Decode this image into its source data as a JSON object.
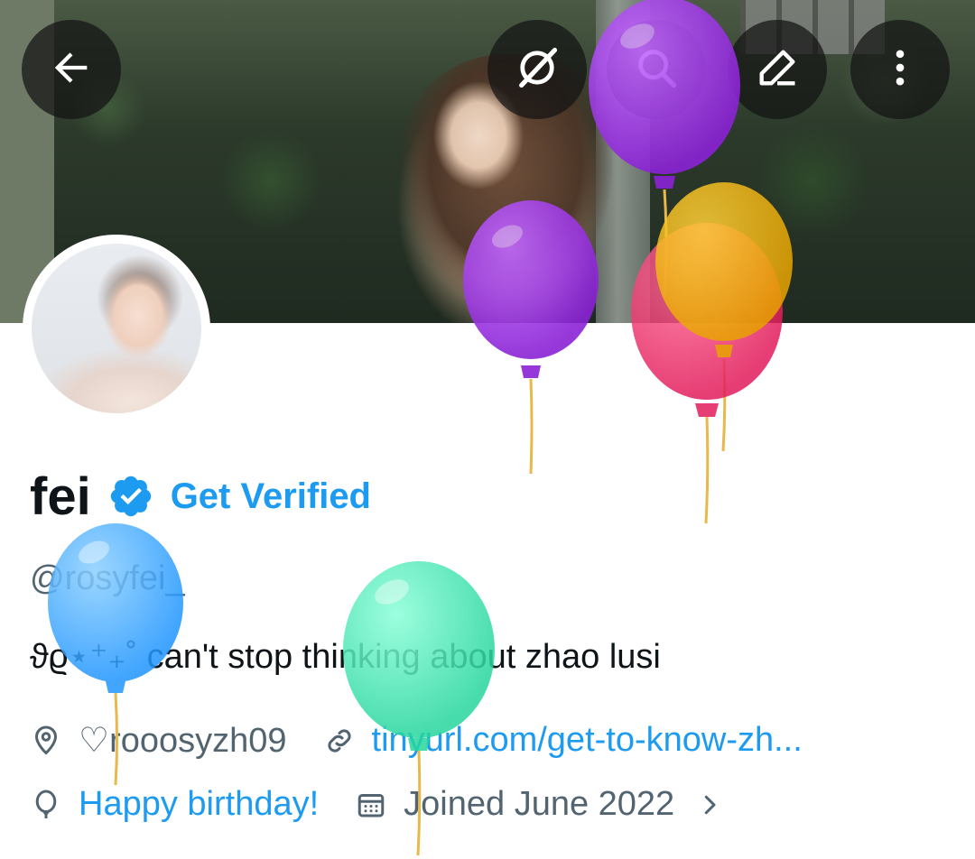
{
  "profile": {
    "name": "fei",
    "get_verified_label": "Get Verified",
    "handle": "@rosyfei_",
    "bio": "ϑϱ⋆⁺₊˚ can't stop thinking about zhao lusi",
    "location": "♡rooosyzh09",
    "website": "tinyurl.com/get-to-know-zh...",
    "birthday": "Happy birthday!",
    "joined": "Joined June 2022"
  },
  "colors": {
    "accent": "#1d9bf0",
    "text_primary": "#0f1419",
    "text_secondary": "#536471",
    "balloon_purple": "#9b33e0",
    "balloon_yellow": "#f2b705",
    "balloon_red": "#ef2f6e",
    "balloon_blue": "#3da9ff",
    "balloon_green": "#3fe6b0"
  },
  "icons": {
    "back": "arrow-left-icon",
    "grok": "slash-circle-icon",
    "search": "search-icon",
    "edit": "pencil-icon",
    "more": "vertical-dots-icon",
    "verified": "verified-badge-icon",
    "location": "location-pin-icon",
    "link": "link-icon",
    "birthday": "balloon-icon",
    "calendar": "calendar-icon",
    "chevron": "chevron-right-icon"
  }
}
